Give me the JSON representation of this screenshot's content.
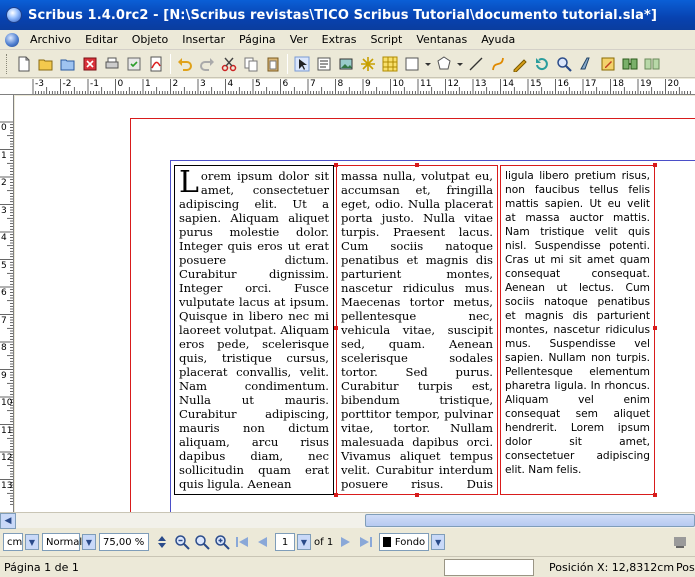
{
  "window": {
    "title": "Scribus 1.4.0rc2 - [N:\\Scribus revistas\\TICO Scribus Tutorial\\documento tutorial.sla*]"
  },
  "menu": [
    "Archivo",
    "Editar",
    "Objeto",
    "Insertar",
    "Página",
    "Ver",
    "Extras",
    "Script",
    "Ventanas",
    "Ayuda"
  ],
  "ruler": {
    "h_labels": [
      "-3",
      "-2",
      "-1",
      "0",
      "1",
      "2",
      "3",
      "4",
      "5",
      "6",
      "7",
      "8",
      "9",
      "10",
      "11",
      "12",
      "13",
      "14",
      "15",
      "16",
      "17",
      "18",
      "19",
      "20"
    ],
    "v_labels": [
      "0",
      "1",
      "2",
      "3",
      "4",
      "5",
      "6",
      "7",
      "8",
      "9",
      "10",
      "11",
      "12",
      "13"
    ]
  },
  "columns": {
    "col1_dropcap": "L",
    "col1": "orem ipsum dolor sit amet, consectetuer adipiscing elit. Ut a sapien. Aliquam aliquet purus molestie dolor. Integer quis eros ut erat posuere dictum. Curabitur dignissim. Integer orci. Fusce vulputate lacus at ipsum. Quisque in libero nec mi laoreet volutpat. Aliquam eros pede, scelerisque quis, tristique cursus, placerat convallis, velit. Nam condimentum. Nulla ut mauris. Curabitur adipiscing, mauris non dictum aliquam, arcu risus dapibus diam, nec sollicitudin quam erat quis ligula. Aenean",
    "col2": "massa nulla, volutpat eu, accumsan et, fringilla eget, odio. Nulla placerat porta justo. Nulla vitae turpis. Praesent lacus. Cum sociis natoque penatibus et magnis dis parturient montes, nascetur ridiculus mus. Maecenas tortor metus, pellentesque nec, vehicula vitae, suscipit sed, quam. Aenean scelerisque sodales tortor. Sed purus. Curabitur turpis est, bibendum tristique, porttitor tempor, pulvinar vitae, tortor. Nullam malesuada dapibus orci. Vivamus aliquet tempus velit. Curabitur interdum posuere risus. Duis egestas, ipsum sit amet molestie tincidunt,",
    "col3": "ligula libero pretium risus, non faucibus tellus felis mattis sapien. Ut eu velit at massa auctor mattis. Nam tristique velit quis nisl. Suspendisse potenti. Cras ut mi sit amet quam consequat consequat. Aenean ut lectus. Cum sociis natoque penatibus et magnis dis parturient montes, nascetur ridiculus mus. Suspendisse vel sapien. Nullam non turpis. Pellentesque elementum pharetra ligula. In rhoncus. Aliquam vel enim consequat sem aliquet hendrerit. Lorem ipsum dolor sit amet, consectetuer adipiscing elit. Nam felis."
  },
  "bottom_toolbar": {
    "unit": "cm",
    "mode": "Normal",
    "zoom": "75,00 %",
    "page_current": "1",
    "page_of": "of 1",
    "layer": "Fondo"
  },
  "status": {
    "page_info": "Página 1 de 1",
    "position_x": "Posición X: 12,8312cm",
    "position_y_partial": "Pos"
  },
  "colors": {
    "page_border": "#d81b1b",
    "margin_guide": "#4b4fc8",
    "titlebar": "#0a5fd6"
  }
}
